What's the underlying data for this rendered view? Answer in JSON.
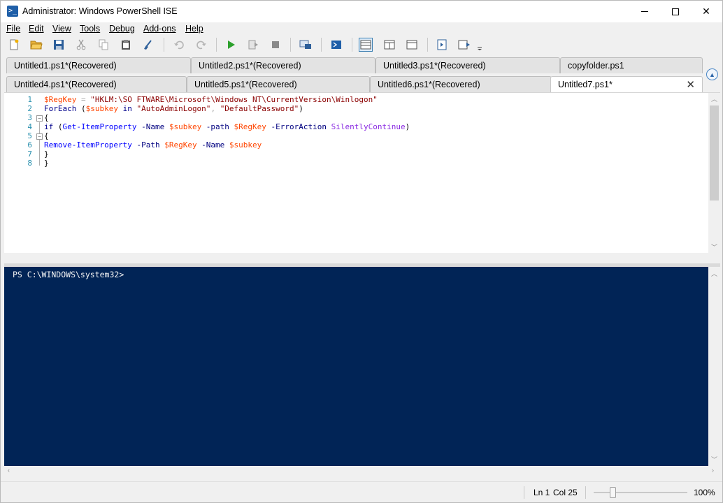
{
  "window": {
    "title": "Administrator: Windows PowerShell ISE",
    "app_icon_glyph": ">_"
  },
  "menu": [
    "File",
    "Edit",
    "View",
    "Tools",
    "Debug",
    "Add-ons",
    "Help"
  ],
  "menu_underline_first": true,
  "toolbar_icons": [
    "new-file-icon",
    "open-folder-icon",
    "save-icon",
    "cut-icon",
    "copy-icon",
    "paste-icon",
    "clear-icon",
    "undo-icon",
    "redo-icon",
    "run-script-icon",
    "run-selection-icon",
    "stop-icon",
    "new-remote-tab-icon",
    "start-powershell-icon",
    "layout-top-icon",
    "layout-right-icon",
    "layout-maximized-icon",
    "show-script-pane-icon",
    "show-command-addon-icon",
    "toolbar-overflow-icon"
  ],
  "tabs_row1": [
    {
      "label": "Untitled1.ps1*(Recovered)"
    },
    {
      "label": "Untitled2.ps1*(Recovered)"
    },
    {
      "label": "Untitled3.ps1*(Recovered)"
    },
    {
      "label": "copyfolder.ps1"
    }
  ],
  "tabs_row2": [
    {
      "label": "Untitled4.ps1*(Recovered)"
    },
    {
      "label": "Untitled5.ps1*(Recovered)"
    },
    {
      "label": "Untitled6.ps1*(Recovered)"
    },
    {
      "label": "Untitled7.ps1*",
      "active": true,
      "close": "✕"
    }
  ],
  "editor": {
    "line_numbers": [
      "1",
      "2",
      "3",
      "4",
      "5",
      "6",
      "7",
      "8"
    ],
    "code": {
      "l1": {
        "var": "$RegKey",
        "eq": " = ",
        "str": "\"HKLM:\\SO FTWARE\\Microsoft\\Windows NT\\CurrentVersion\\Winlogon\""
      },
      "l2": {
        "kw": "ForEach",
        "open": " (",
        "var": "$subkey",
        "kwin": " in ",
        "str1": "\"AutoAdminLogon\"",
        "comma": ", ",
        "str2": "\"DefaultPassword\"",
        "close": ")"
      },
      "l3": {
        "brace": "{"
      },
      "l4": {
        "kw": "if",
        "open": " (",
        "cmd": "Get-ItemProperty",
        "p1": " -Name ",
        "v1": "$subkey",
        "p2": " -path ",
        "v2": "$RegKey",
        "p3": " -ErrorAction ",
        "arg": "SilentlyContinue",
        "close": ")"
      },
      "l5": {
        "brace": "{"
      },
      "l6": {
        "cmd": "Remove-ItemProperty",
        "p1": " -Path ",
        "v1": "$RegKey",
        "p2": " -Name ",
        "v2": "$subkey"
      },
      "l7": {
        "brace": "}"
      },
      "l8": {
        "brace": "}"
      }
    }
  },
  "console": {
    "prompt": "PS C:\\WINDOWS\\system32>"
  },
  "status": {
    "ln": "Ln 1",
    "col": "Col 25",
    "zoom": "100%",
    "zoom_value": 100
  },
  "colors": {
    "console_bg": "#012456",
    "variable": "#ff4500",
    "string": "#8b0000",
    "keyword": "#00008b",
    "command": "#0000ff",
    "parameter": "#000080",
    "command_argument": "#8a2be2",
    "line_number": "#2b91af"
  }
}
